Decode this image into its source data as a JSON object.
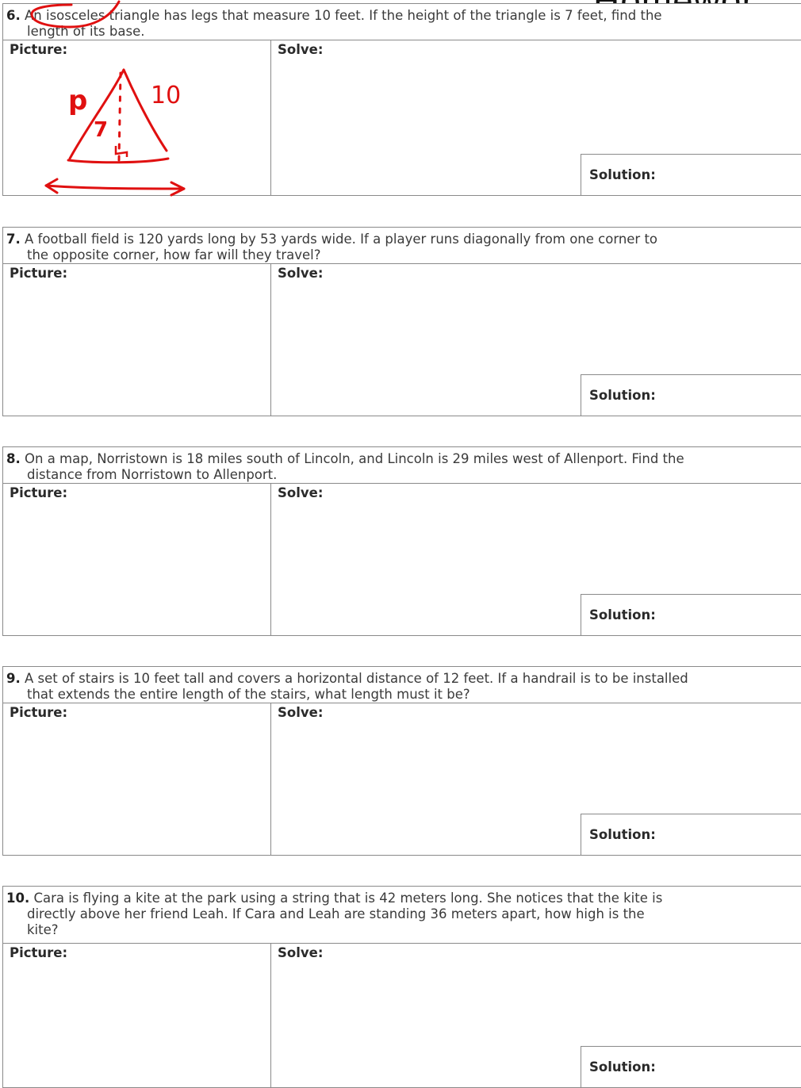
{
  "header": {
    "word": "Homewor"
  },
  "problems": [
    {
      "number": "6.",
      "line1": "An isosceles triangle has legs that measure 10 feet.  If the height of the triangle is 7 feet, find the",
      "line2": "length of its base.",
      "picture_label": "Picture:",
      "solve_label": "Solve:",
      "solution_label": "Solution:",
      "annotations": {
        "side_label": "10",
        "height_label": "7",
        "marker": "p"
      }
    },
    {
      "number": "7.",
      "line1": "A football field is 120 yards long by 53 yards wide.  If a player runs diagonally from one corner to",
      "line2": "the opposite corner, how far will they travel?",
      "picture_label": "Picture:",
      "solve_label": "Solve:",
      "solution_label": "Solution:"
    },
    {
      "number": "8.",
      "line1": "On a map, Norristown is 18 miles south of Lincoln, and Lincoln is 29 miles west of Allenport.  Find the",
      "line2": "distance from Norristown to Allenport.",
      "picture_label": "Picture:",
      "solve_label": "Solve:",
      "solution_label": "Solution:"
    },
    {
      "number": "9.",
      "line1": "A set of stairs is 10 feet tall and covers a horizontal distance of 12 feet.  If a handrail is to be installed",
      "line2": "that extends the entire length of the stairs, what length must it be?",
      "picture_label": "Picture:",
      "solve_label": "Solve:",
      "solution_label": "Solution:"
    },
    {
      "number": "10.",
      "line1": " Cara is flying a kite at the park using a string that is 42 meters long.  She notices that the kite is",
      "line2": "directly above her friend Leah.  If Cara and Leah are standing 36 meters apart, how high is the",
      "line3": "kite?",
      "picture_label": "Picture:",
      "solve_label": "Solve:",
      "solution_label": "Solution:"
    }
  ],
  "colors": {
    "ink_red": "#e01010",
    "border": "#8a8a8a",
    "text": "#3a3a3a"
  }
}
